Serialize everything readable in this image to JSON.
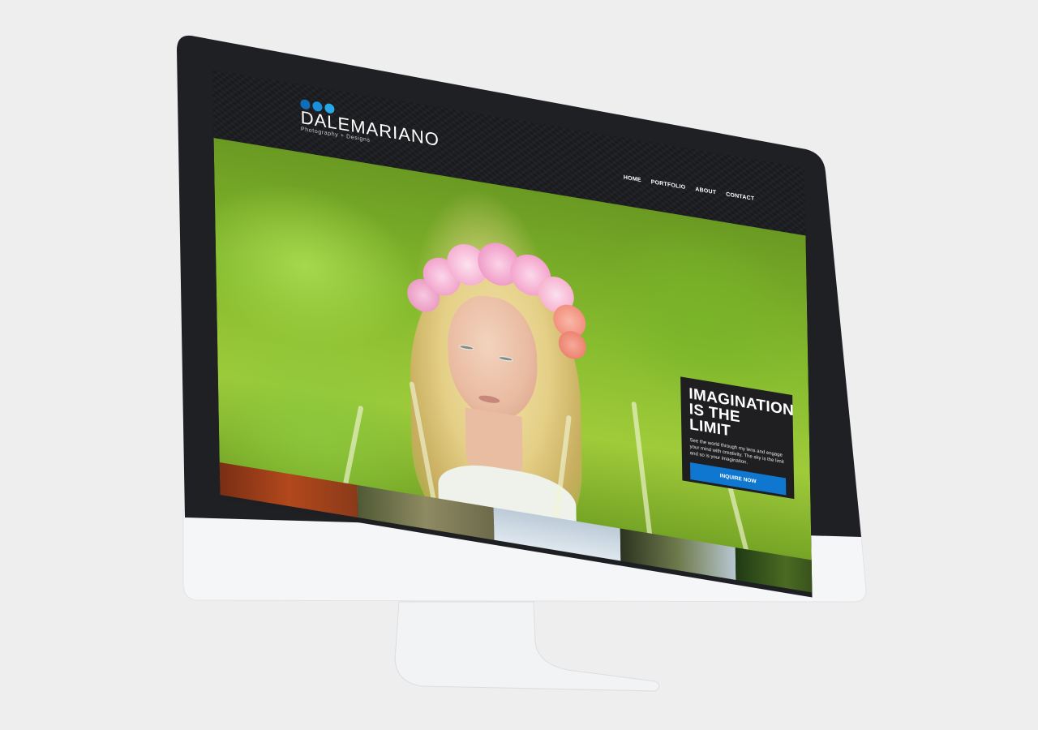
{
  "site": {
    "logo": {
      "name": "DALEMARIANO",
      "tagline": "Photography + Designs",
      "dot_colors": [
        "#1077d1",
        "#1a8fdc",
        "#27a7ea"
      ]
    },
    "nav": {
      "items": [
        {
          "label": "HOME"
        },
        {
          "label": "PORTFOLIO"
        },
        {
          "label": "ABOUT"
        },
        {
          "label": "CONTACT"
        }
      ]
    },
    "hero": {
      "title_line1": "IMAGINATION",
      "title_line2": "IS THE LIMIT",
      "text": "See the world through my lens and engage your mind with creativity. The sky is the limit and so is your imagination.",
      "button_label": "INQUIRE NOW"
    }
  },
  "colors": {
    "accent": "#1077d1",
    "bezel": "#1e1f22",
    "chassis": "#f5f6f8",
    "background": "#eeeeef"
  }
}
